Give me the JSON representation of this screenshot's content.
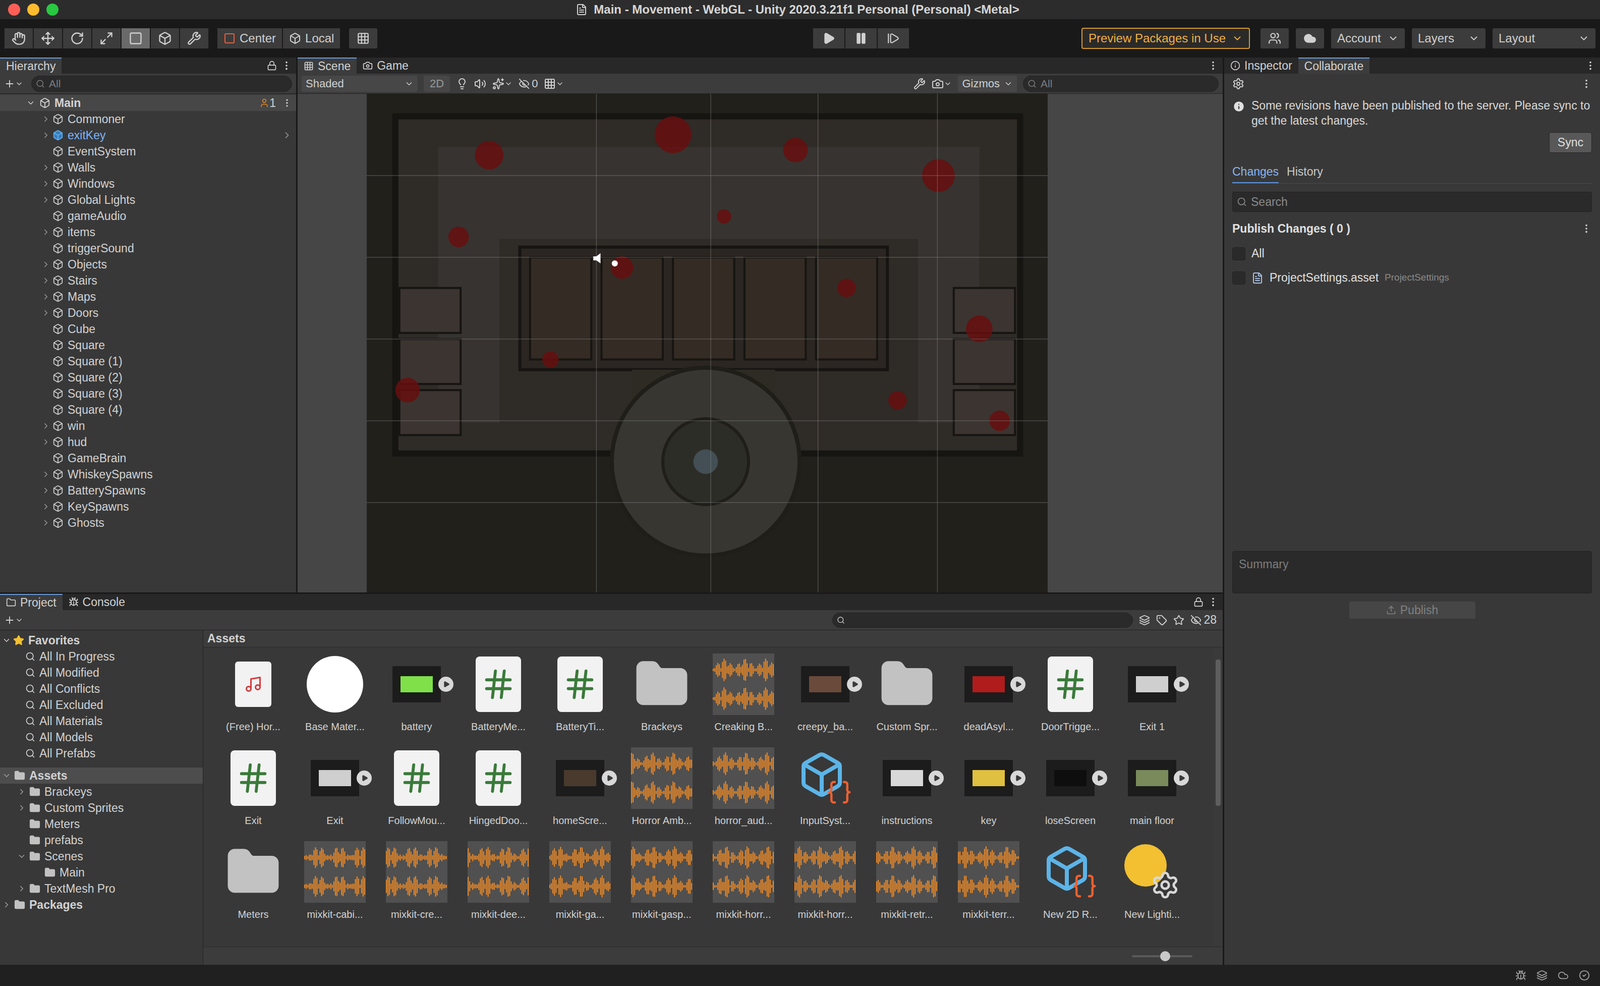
{
  "window": {
    "title": "Main - Movement - WebGL - Unity 2020.3.21f1 Personal (Personal) <Metal>"
  },
  "toolbar": {
    "tools": [
      {
        "kind": "hand",
        "selected": false
      },
      {
        "kind": "move",
        "selected": false
      },
      {
        "kind": "rotate",
        "selected": false
      },
      {
        "kind": "scale",
        "selected": false
      },
      {
        "kind": "rect",
        "selected": true
      },
      {
        "kind": "transform",
        "selected": false
      },
      {
        "kind": "custom",
        "selected": false
      }
    ],
    "pivot": "Center",
    "space": "Local",
    "packages": "Preview Packages in Use",
    "menus": [
      "Account",
      "Layers",
      "Layout"
    ]
  },
  "hierarchy": {
    "title": "Hierarchy",
    "search": "All",
    "scene": "Main",
    "users": "1",
    "items": [
      {
        "name": "Commoner",
        "children": true,
        "prefab": false
      },
      {
        "name": "exitKey",
        "children": true,
        "prefab": true
      },
      {
        "name": "EventSystem",
        "children": false,
        "prefab": false
      },
      {
        "name": "Walls",
        "children": true,
        "prefab": false
      },
      {
        "name": "Windows",
        "children": true,
        "prefab": false
      },
      {
        "name": "Global Lights",
        "children": true,
        "prefab": false
      },
      {
        "name": "gameAudio",
        "children": false,
        "prefab": false
      },
      {
        "name": "items",
        "children": true,
        "prefab": false
      },
      {
        "name": "triggerSound",
        "children": false,
        "prefab": false
      },
      {
        "name": "Objects",
        "children": true,
        "prefab": false
      },
      {
        "name": "Stairs",
        "children": true,
        "prefab": false
      },
      {
        "name": "Maps",
        "children": true,
        "prefab": false
      },
      {
        "name": "Doors",
        "children": true,
        "prefab": false
      },
      {
        "name": "Cube",
        "children": false,
        "prefab": false
      },
      {
        "name": "Square",
        "children": false,
        "prefab": false
      },
      {
        "name": "Square (1)",
        "children": false,
        "prefab": false
      },
      {
        "name": "Square (2)",
        "children": false,
        "prefab": false
      },
      {
        "name": "Square (3)",
        "children": false,
        "prefab": false
      },
      {
        "name": "Square (4)",
        "children": false,
        "prefab": false
      },
      {
        "name": "win",
        "children": true,
        "prefab": false
      },
      {
        "name": "hud",
        "children": true,
        "prefab": false
      },
      {
        "name": "GameBrain",
        "children": false,
        "prefab": false
      },
      {
        "name": "WhiskeySpawns",
        "children": true,
        "prefab": false
      },
      {
        "name": "BatterySpawns",
        "children": true,
        "prefab": false
      },
      {
        "name": "KeySpawns",
        "children": true,
        "prefab": false
      },
      {
        "name": "Ghosts",
        "children": true,
        "prefab": false
      }
    ]
  },
  "scene": {
    "tabs": [
      {
        "label": "Scene",
        "selected": true
      },
      {
        "label": "Game",
        "selected": false
      }
    ],
    "shading": "Shaded",
    "mode_2d": "2D",
    "mode_2d_on": false,
    "hidden": "0",
    "gizmos": "Gizmos",
    "search": "All"
  },
  "inspector": {
    "tabs": [
      {
        "label": "Inspector",
        "selected": false
      },
      {
        "label": "Collaborate",
        "selected": true
      }
    ],
    "notice": "Some revisions have been published to the server. Please sync to get the latest changes.",
    "sync": "Sync",
    "subtabs": [
      {
        "label": "Changes",
        "selected": true
      },
      {
        "label": "History",
        "selected": false
      }
    ],
    "search": "Search",
    "publish_header": "Publish Changes ( 0 )",
    "changes": [
      {
        "label": "All",
        "detail": "",
        "checked": false
      },
      {
        "label": "ProjectSettings.asset",
        "detail": "ProjectSettings",
        "checked": false
      }
    ],
    "summary": "Summary",
    "publish": {
      "label": "Publish",
      "disabled": true
    }
  },
  "project": {
    "tabs": [
      {
        "label": "Project",
        "selected": true
      },
      {
        "label": "Console",
        "selected": false
      }
    ],
    "hidden": "28",
    "favorites": {
      "label": "Favorites",
      "expanded": true,
      "items": [
        "All In Progress",
        "All Modified",
        "All Conflicts",
        "All Excluded",
        "All Materials",
        "All Models",
        "All Prefabs"
      ]
    },
    "tree": [
      {
        "label": "Assets",
        "depth": 0,
        "children": true,
        "expanded": true,
        "selected": true
      },
      {
        "label": "Brackeys",
        "depth": 1,
        "children": true,
        "expanded": false,
        "selected": false
      },
      {
        "label": "Custom Sprites",
        "depth": 1,
        "children": true,
        "expanded": false,
        "selected": false
      },
      {
        "label": "Meters",
        "depth": 1,
        "children": false,
        "expanded": false,
        "selected": false
      },
      {
        "label": "prefabs",
        "depth": 1,
        "children": false,
        "expanded": false,
        "selected": false
      },
      {
        "label": "Scenes",
        "depth": 1,
        "children": true,
        "expanded": true,
        "selected": false
      },
      {
        "label": "Main",
        "depth": 2,
        "children": false,
        "expanded": false,
        "selected": false
      },
      {
        "label": "TextMesh Pro",
        "depth": 1,
        "children": true,
        "expanded": false,
        "selected": false
      },
      {
        "label": "Packages",
        "depth": 0,
        "children": true,
        "expanded": false,
        "selected": false
      }
    ],
    "breadcrumb": "Assets",
    "assets": [
      {
        "name": "(Free) Hor...",
        "kind": "audio-doc",
        "sub": false
      },
      {
        "name": "Base Mater...",
        "kind": "material",
        "sub": false
      },
      {
        "name": "battery",
        "kind": "image",
        "sub": true,
        "color": "#7fe04a"
      },
      {
        "name": "BatteryMe...",
        "kind": "script",
        "sub": false
      },
      {
        "name": "BatteryTi...",
        "kind": "script",
        "sub": false
      },
      {
        "name": "Brackeys",
        "kind": "folder",
        "sub": false
      },
      {
        "name": "Creaking B...",
        "kind": "audio",
        "sub": false
      },
      {
        "name": "creepy_ba...",
        "kind": "image",
        "sub": true,
        "color": "#6a4a3a"
      },
      {
        "name": "Custom Spr...",
        "kind": "folder",
        "sub": false
      },
      {
        "name": "deadAsyl...",
        "kind": "image",
        "sub": true,
        "color": "#b01c1c"
      },
      {
        "name": "DoorTrigge...",
        "kind": "script",
        "sub": false
      },
      {
        "name": "Exit 1",
        "kind": "image",
        "sub": true,
        "color": "#cfcfcf"
      },
      {
        "name": "Exit",
        "kind": "script",
        "sub": false
      },
      {
        "name": "Exit",
        "kind": "image",
        "sub": true,
        "color": "#cfcfcf"
      },
      {
        "name": "FollowMou...",
        "kind": "script",
        "sub": false
      },
      {
        "name": "HingedDoo...",
        "kind": "script",
        "sub": false
      },
      {
        "name": "homeScre...",
        "kind": "image",
        "sub": true,
        "color": "#4a3a2e"
      },
      {
        "name": "Horror Amb...",
        "kind": "audio",
        "sub": false
      },
      {
        "name": "horror_aud...",
        "kind": "audio",
        "sub": false
      },
      {
        "name": "InputSyst...",
        "kind": "input",
        "sub": false
      },
      {
        "name": "instructions",
        "kind": "image",
        "sub": true,
        "color": "#d8d8d8"
      },
      {
        "name": "key",
        "kind": "image",
        "sub": true,
        "color": "#e0c040"
      },
      {
        "name": "loseScreen",
        "kind": "image",
        "sub": true,
        "color": "#0e0e0e"
      },
      {
        "name": "main floor",
        "kind": "image",
        "sub": true,
        "color": "#7a8a5a"
      },
      {
        "name": "Meters",
        "kind": "folder",
        "sub": false
      },
      {
        "name": "mixkit-cabi...",
        "kind": "audio",
        "sub": false
      },
      {
        "name": "mixkit-cre...",
        "kind": "audio",
        "sub": false
      },
      {
        "name": "mixkit-dee...",
        "kind": "audio",
        "sub": false
      },
      {
        "name": "mixkit-ga...",
        "kind": "audio",
        "sub": false
      },
      {
        "name": "mixkit-gasp...",
        "kind": "audio",
        "sub": false
      },
      {
        "name": "mixkit-horr...",
        "kind": "audio",
        "sub": false
      },
      {
        "name": "mixkit-horr...",
        "kind": "audio",
        "sub": false
      },
      {
        "name": "mixkit-retr...",
        "kind": "audio",
        "sub": false
      },
      {
        "name": "mixkit-terr...",
        "kind": "audio",
        "sub": false
      },
      {
        "name": "New 2D R...",
        "kind": "renderer",
        "sub": false
      },
      {
        "name": "New Lighti...",
        "kind": "light",
        "sub": false
      }
    ]
  }
}
